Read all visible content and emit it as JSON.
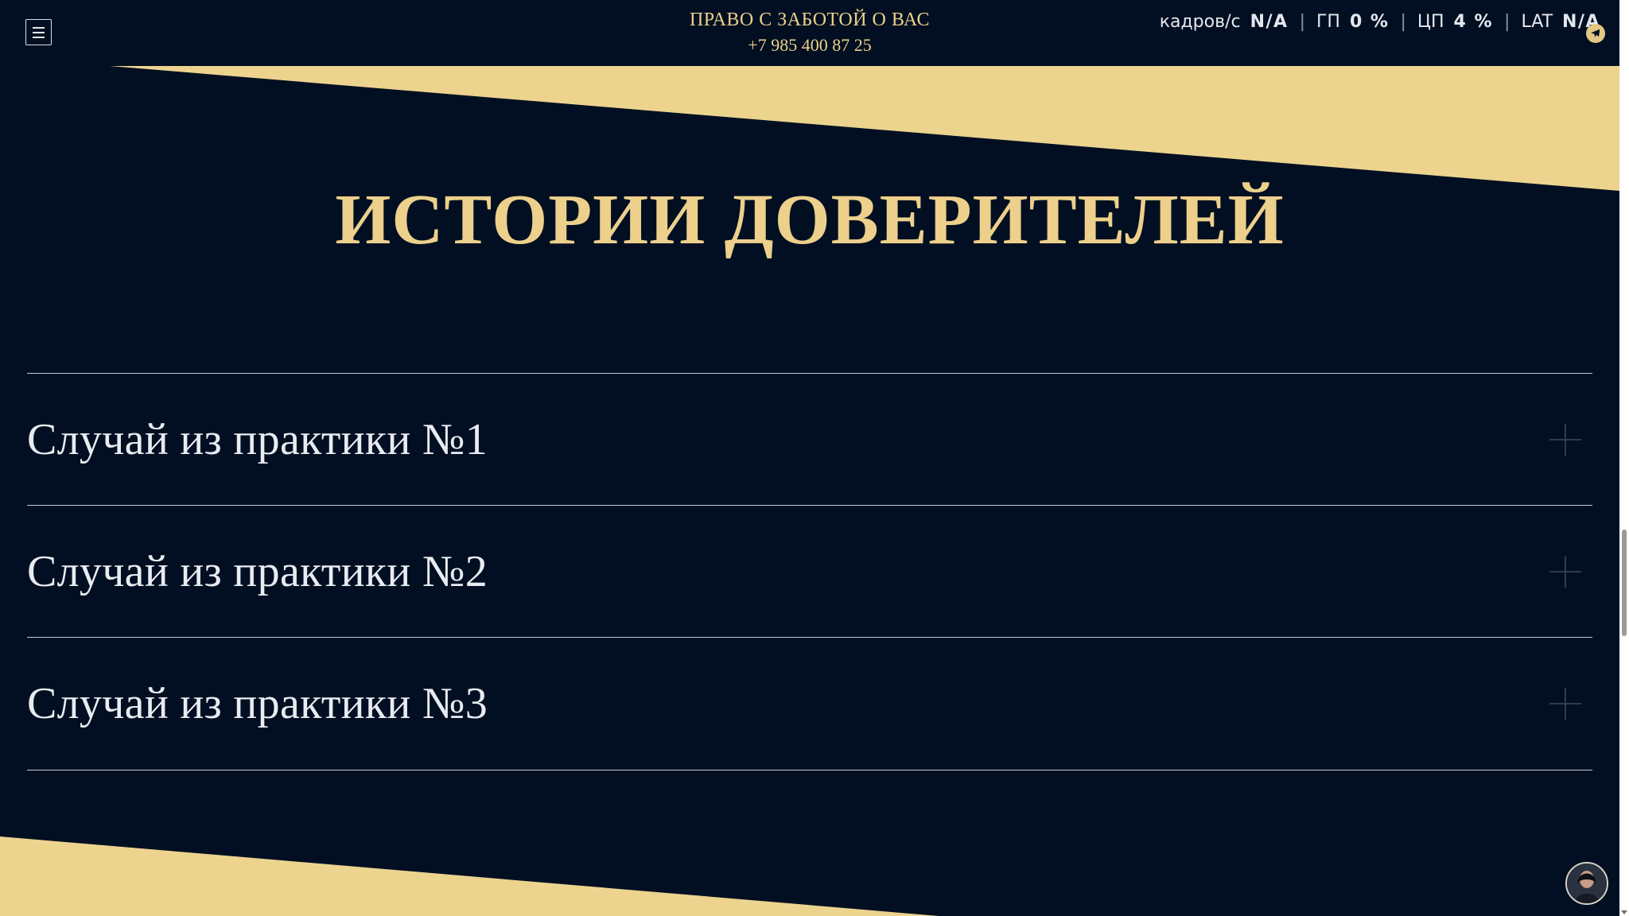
{
  "header": {
    "brand_title": "ПРАВО С ЗАБОТОЙ О ВАС",
    "phone": "+7 985 400 87 25",
    "menu_icon": "hamburger-menu-icon",
    "telegram_icon": "telegram-icon"
  },
  "stats": {
    "fps_label": "кадров/с",
    "fps_value": "N/A",
    "gpu_label": "ГП",
    "gpu_value": "0 %",
    "cpu_label": "ЦП",
    "cpu_value": "4 %",
    "lat_label": "LAT",
    "lat_value": "N/A"
  },
  "main": {
    "heading": "ИСТОРИИ ДОВЕРИТЕЛЕЙ",
    "cases": [
      {
        "title": "Случай из практики №1"
      },
      {
        "title": "Случай из практики №2"
      },
      {
        "title": "Случай из практики №3"
      }
    ]
  },
  "colors": {
    "background": "#020f22",
    "gold": "#ecd08b",
    "text": "#e8ecf1"
  }
}
